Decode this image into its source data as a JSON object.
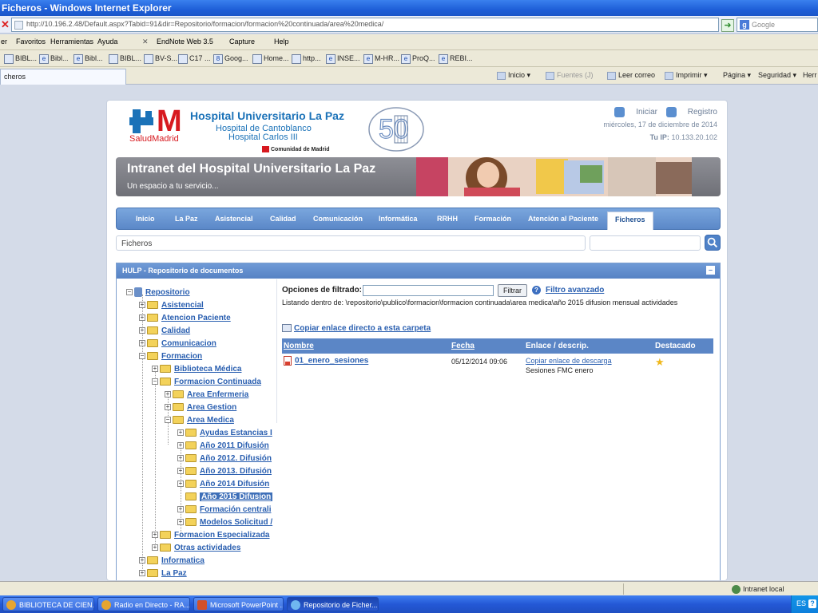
{
  "window": {
    "title": "Ficheros - Windows Internet Explorer"
  },
  "address": {
    "url": "http://10.196.2.48/Default.aspx?Tabid=91&dir=Repositorio/formacion/formacion%20continuada/area%20medica/",
    "search_placeholder": "Google"
  },
  "menu": [
    "er",
    "Favoritos",
    "Herramientas",
    "Ayuda"
  ],
  "menu_extras": [
    "EndNote Web 3.5",
    "Capture",
    "Help"
  ],
  "links": [
    "BIBL...",
    "Bibl...",
    "Bibl...",
    "BIBL...",
    "BV-S...",
    "C17 ...",
    "Goog...",
    "Home...",
    "http...",
    "INSE...",
    "M-HR...",
    "ProQ...",
    "REBI..."
  ],
  "tab": {
    "label": "cheros"
  },
  "commands": [
    "Inicio",
    "Fuentes (J)",
    "Leer correo",
    "Imprimir",
    "Página",
    "Seguridad",
    "Herr"
  ],
  "header": {
    "logo_brand": "SaludMadrid",
    "logo_letter": "M",
    "hospital_title": "Hospital Universitario La Paz",
    "hospital_sub1": "Hospital de Cantoblanco",
    "hospital_sub2": "Hospital Carlos III",
    "comunidad": "Comunidad de Madrid",
    "login": "Iniciar",
    "register": "Registro",
    "date": "miércoles, 17 de diciembre de 2014",
    "ip_label": "Tu IP:",
    "ip_value": "10.133.20.102"
  },
  "banner": {
    "title": "Intranet del Hospital Universitario La Paz",
    "subtitle": "Un espacio a tu servicio..."
  },
  "nav": [
    "Inicio",
    "La Paz",
    "Asistencial",
    "Calidad",
    "Comunicación",
    "Informática",
    "RRHH",
    "Formación",
    "Atención al Paciente",
    "Ficheros"
  ],
  "breadcrumb": "Ficheros",
  "panel": {
    "title": "HULP - Repositorio de documentos",
    "filter_label": "Opciones de filtrado:",
    "filter_button": "Filtrar",
    "advanced": "Filtro avanzado",
    "listing": "Listando dentro de: \\repositorio\\publico\\formacion\\formacion continuada\\area medica\\año 2015 difusion mensual actividades",
    "copy_link": "Copiar enlace directo a esta carpeta",
    "columns": [
      "Nombre",
      "Fecha",
      "Enlace / descrip.",
      "Destacado"
    ],
    "files": [
      {
        "name": "01_enero_sesiones",
        "date": "05/12/2014 09:06",
        "link": "Copiar enlace de descarga",
        "desc": "Sesiones FMC enero"
      }
    ]
  },
  "tree": {
    "root": "Repositorio",
    "level1": [
      "Asistencial",
      "Atencion Paciente",
      "Calidad",
      "Comunicacion",
      "Formacion"
    ],
    "formacion_children": [
      "Biblioteca Médica",
      "Formacion Continuada"
    ],
    "continuada_children": [
      "Area Enfermeria",
      "Area Gestion",
      "Area Medica"
    ],
    "medica_children": [
      "Ayudas Estancias I",
      "Año 2011 Difusión",
      "Año 2012. Difusión",
      "Año 2013. Difusión",
      "Año 2014 Difusión",
      "Año 2015 Difusion",
      "Formación centrali",
      "Modelos Solicitud /"
    ],
    "formacion_tail": [
      "Formacion Especializada",
      "Otras actividades"
    ],
    "level1_tail": [
      "Informatica",
      "La Paz"
    ]
  },
  "status": {
    "zone": "Intranet local"
  },
  "taskbar": {
    "tasks": [
      "BIBLIOTECA DE CIEN...",
      "Radio en Directo - RA...",
      "Microsoft PowerPoint ...",
      "Repositorio de Ficher..."
    ],
    "lang": "ES"
  }
}
